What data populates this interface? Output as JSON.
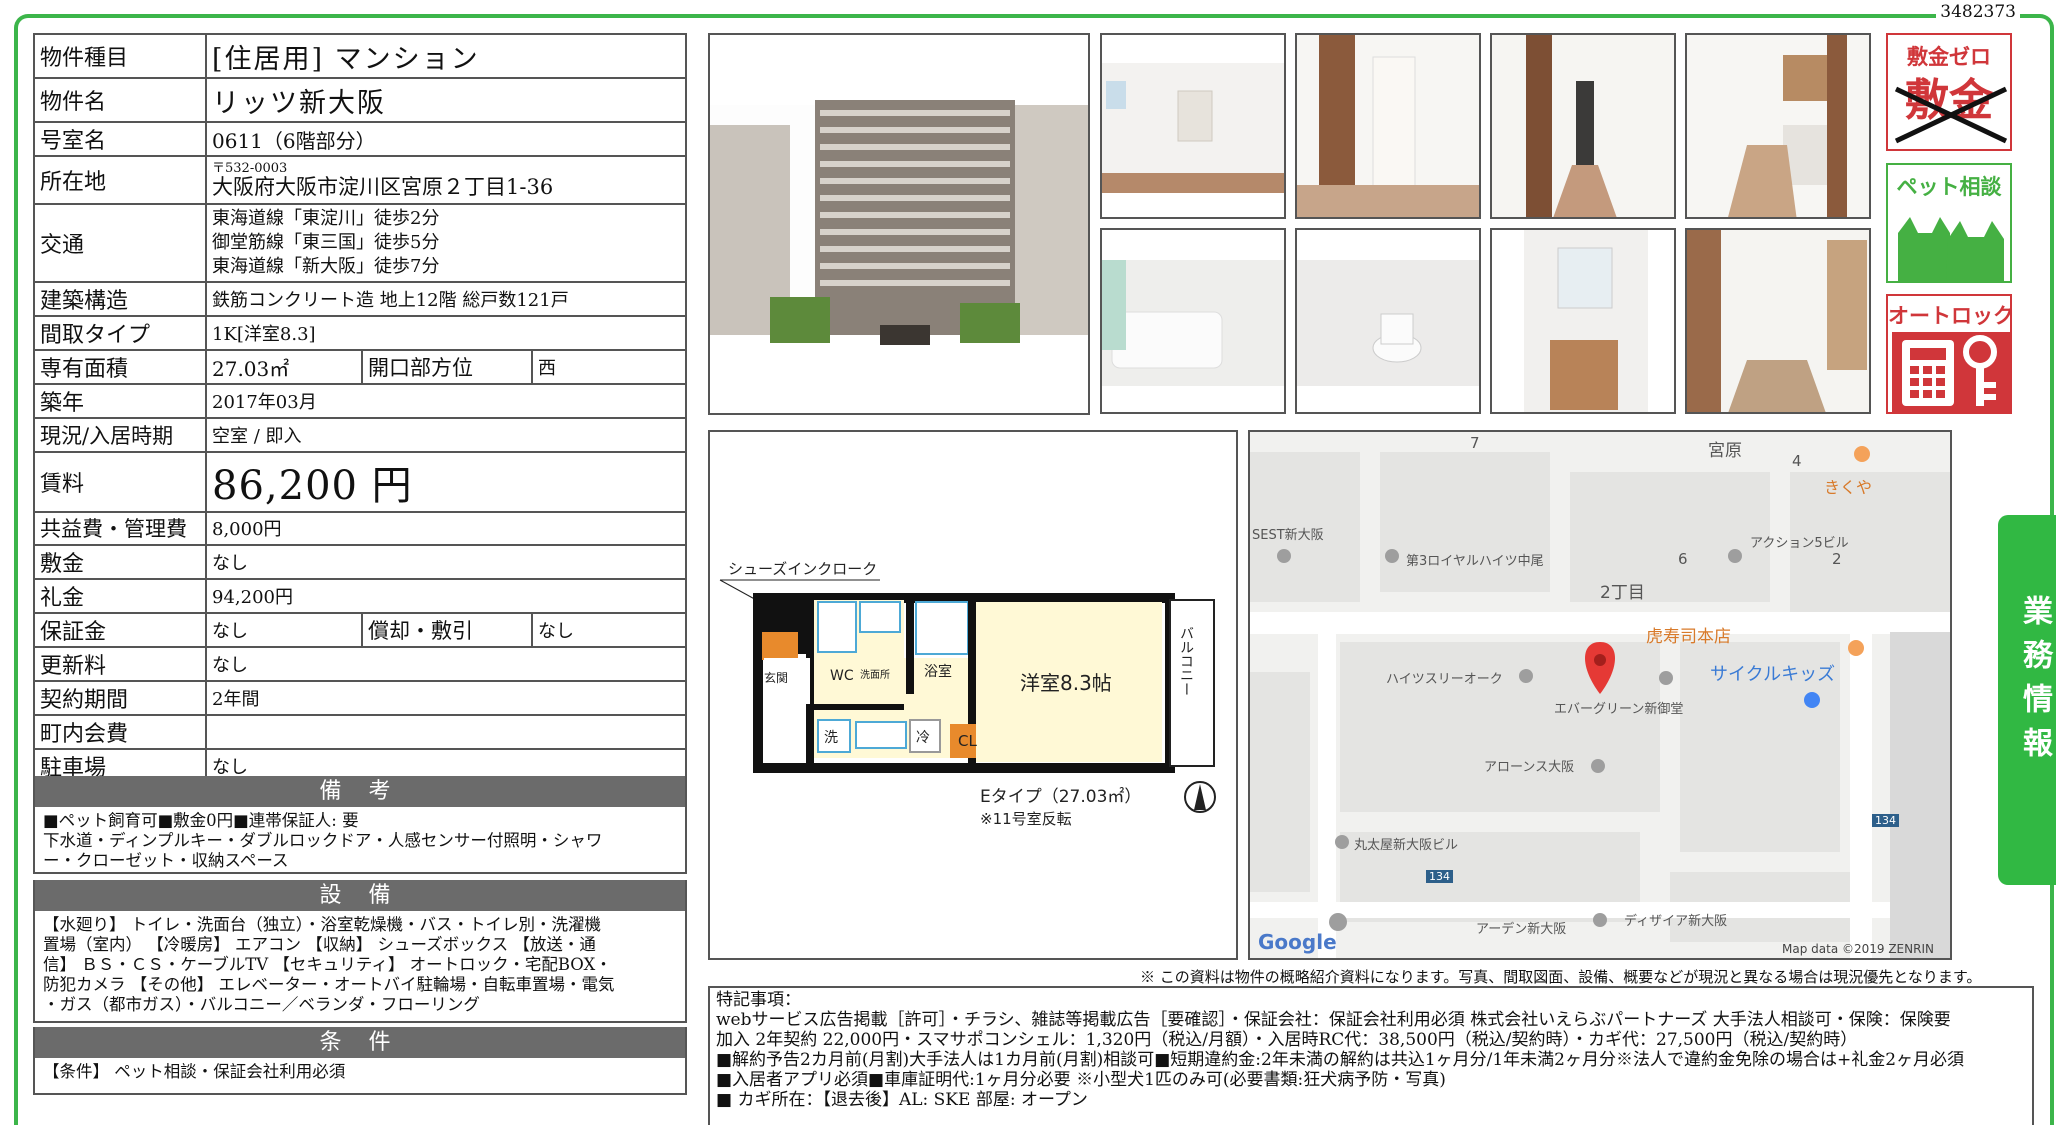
{
  "doc_id": "3482373",
  "property": {
    "type_label": "物件種目",
    "type_value": "[住居用] マンション",
    "name_label": "物件名",
    "name_value": "リッツ新大阪",
    "room_label": "号室名",
    "room_value": "0611（6階部分）",
    "address_label": "所在地",
    "postal": "〒532-0003",
    "address": "大阪府大阪市淀川区宮原２丁目1-36",
    "transit_label": "交通",
    "transit": [
      "東海道線「東淀川」徒歩2分",
      "御堂筋線「東三国」徒歩5分",
      "東海道線「新大阪」徒歩7分"
    ],
    "structure_label": "建築構造",
    "structure_value": "鉄筋コンクリート造 地上12階 総戸数121戸",
    "layout_label": "間取タイプ",
    "layout_value": "1K[洋室8.3]",
    "area_label": "専有面積",
    "area_value": "27.03㎡",
    "direction_label": "開口部方位",
    "direction_value": "西",
    "built_label": "築年",
    "built_value": "2017年03月",
    "status_label": "現況/入居時期",
    "status_value": "空室 / 即入",
    "rent_label": "賃料",
    "rent_value": "86,200 円",
    "fee_label": "共益費・管理費",
    "fee_value": "8,000円",
    "deposit_label": "敷金",
    "deposit_value": "なし",
    "keymoney_label": "礼金",
    "keymoney_value": "94,200円",
    "guarantee_label": "保証金",
    "guarantee_value": "なし",
    "amort_label": "償却・敷引",
    "amort_value": "なし",
    "renewal_label": "更新料",
    "renewal_value": "なし",
    "contract_label": "契約期間",
    "contract_value": "2年間",
    "community_label": "町内会費",
    "community_value": "",
    "parking_label": "駐車場",
    "parking_value": "なし"
  },
  "remarks": {
    "title": "備 考",
    "body": "■ペット飼育可■敷金0円■連帯保証人: 要\n下水道・ディンプルキー・ダブルロックドア・人感センサー付照明・シャワ\nー・クローゼット・収納スペース"
  },
  "equipment": {
    "title": "設 備",
    "body": "【水廻り】 トイレ・洗面台（独立）・浴室乾燥機・バス・トイレ別・洗濯機\n置場（室内） 【冷暖房】 エアコン 【収納】 シューズボックス 【放送・通\n信】 ＢＳ・ＣＳ・ケーブルTV 【セキュリティ】 オートロック・宅配BOX・\n防犯カメラ 【その他】 エレベーター・オートバイ駐輪場・自転車置場・電気\n・ガス（都市ガス）・バルコニー／ベランダ・フローリング"
  },
  "conditions": {
    "title": "条 件",
    "body": "【条件】 ペット相談・保証会社利用必須"
  },
  "badges": {
    "deposit_zero_title": "敷金ゼロ",
    "deposit_zero_crossed": "敷金",
    "pet_title": "ペット相談",
    "autolock_title": "オートロック"
  },
  "side_tab": "業務情報",
  "floorplan": {
    "shoes_closet": "シューズインクローク",
    "wc": "WC",
    "washroom": "洗面所",
    "bath": "浴室",
    "western_room": "洋室8.3帖",
    "balcony": "バルコニー",
    "entrance": "玄関",
    "wash": "洗",
    "fridge": "冷",
    "cl": "CL",
    "type": "Eタイプ（27.03㎡）",
    "note": "※11号室反転"
  },
  "map": {
    "labels": [
      "宮原",
      "7",
      "4",
      "きくや",
      "SEST新大阪",
      "第3ロイヤルハイツ中尾",
      "アクション5ビル",
      "6",
      "2",
      "2丁目",
      "虎寿司本店",
      "サイクルキッズ",
      "ハイツスリーオーク",
      "エバーグリーン新御堂",
      "アローンス大阪",
      "丸太屋新大阪ビル",
      "134",
      "134",
      "ディザイア新大阪",
      "アーデン新大阪"
    ],
    "google": "Google",
    "credit": "Map data ©2019 ZENRIN"
  },
  "disclaimer": "※ この資料は物件の概略紹介資料になります。写真、間取図面、設備、概要などが現況と異なる場合は現況優先となります。",
  "notes": {
    "title": "特記事項：",
    "lines": [
      "webサービス広告掲載［許可］・チラシ、雑誌等掲載広告［要確認］・保証会社：保証会社利用必須 株式会社いえらぶパートナーズ 大手法人相談可・保険：保険要",
      "加入 2年契約 22,000円・スマサポコンシェル：1,320円（税込/月額）・入居時RC代：38,500円（税込/契約時）・カギ代：27,500円（税込/契約時）",
      "■解約予告2カ月前(月割)大手法人は1カ月前(月割)相談可■短期違約金:2年未満の解約は共込1ヶ月分/1年未満2ヶ月分※法人で違約金免除の場合は+礼金2ヶ月必須",
      "■入居者アプリ必須■車庫証明代:1ヶ月分必要 ※小型犬1匹のみ可(必要書類:狂犬病予防・写真)",
      "■ カギ所在：【退去後】AL: SKE 部屋: オープン"
    ]
  }
}
